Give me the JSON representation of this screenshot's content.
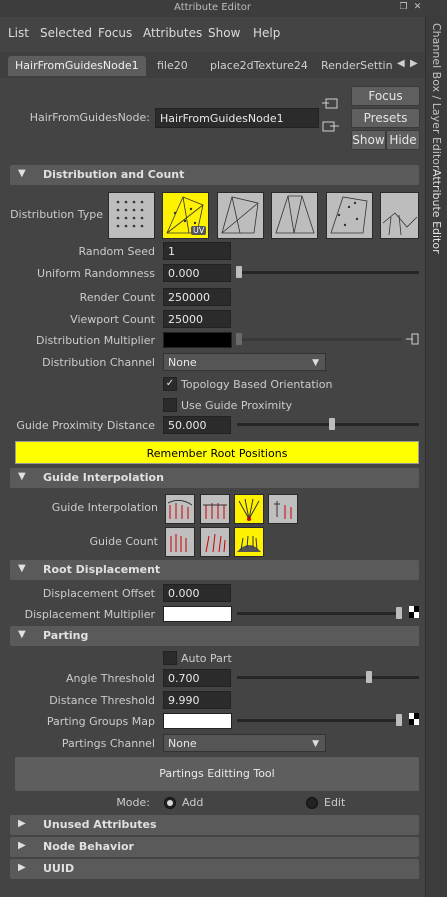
{
  "window": {
    "title": "Attribute Editor"
  },
  "menu": [
    "List",
    "Selected",
    "Focus",
    "Attributes",
    "Show",
    "Help"
  ],
  "side_tabs": {
    "channel_box": "Channel Box / Layer Editor",
    "attribute_editor": "Attribute Editor"
  },
  "tabs": [
    "HairFromGuidesNode1",
    "file20",
    "place2dTexture24",
    "RenderSettin"
  ],
  "node": {
    "label": "HairFromGuidesNode:",
    "value": "HairFromGuidesNode1"
  },
  "buttons": {
    "focus": "Focus",
    "presets": "Presets",
    "show": "Show",
    "hide": "Hide"
  },
  "sections": {
    "distribution": "Distribution and Count",
    "guide_interp": "Guide Interpolation",
    "root_disp": "Root Displacement",
    "parting": "Parting",
    "unused": "Unused Attributes",
    "node_behavior": "Node Behavior",
    "uuid": "UUID"
  },
  "distribution": {
    "type_label": "Distribution Type",
    "uv_badge": "UV",
    "random_seed_label": "Random Seed",
    "random_seed": "1",
    "uniform_label": "Uniform Randomness",
    "uniform": "0.000",
    "render_count_label": "Render Count",
    "render_count": "250000",
    "viewport_count_label": "Viewport Count",
    "viewport_count": "25000",
    "dist_mult_label": "Distribution Multiplier",
    "dist_channel_label": "Distribution Channel",
    "dist_channel": "None",
    "topology_label": "Topology Based Orientation",
    "use_guide_label": "Use Guide Proximity",
    "guide_prox_label": "Guide Proximity Distance",
    "guide_prox": "50.000",
    "remember_btn": "Remember Root Positions"
  },
  "guide": {
    "interp_label": "Guide Interpolation",
    "count_label": "Guide Count"
  },
  "root": {
    "offset_label": "Displacement Offset",
    "offset": "0.000",
    "mult_label": "Displacement Multiplier"
  },
  "parting": {
    "auto_label": "Auto Part",
    "angle_label": "Angle Threshold",
    "angle": "0.700",
    "distance_label": "Distance Threshold",
    "distance": "9.990",
    "groups_label": "Parting Groups Map",
    "channel_label": "Partings Channel",
    "channel": "None",
    "tool_btn": "Partings Editting Tool",
    "mode_label": "Mode:",
    "mode_add": "Add",
    "mode_edit": "Edit"
  },
  "colors": {
    "selected_tile": "#fff200",
    "remember_button": "#ffff00"
  }
}
